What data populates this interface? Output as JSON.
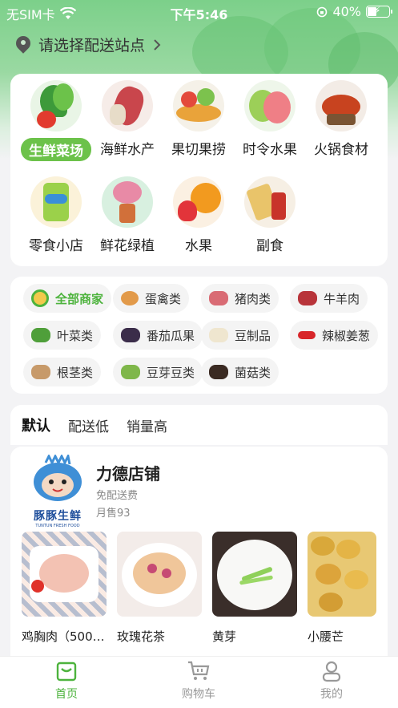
{
  "status": {
    "carrier": "无SIM卡",
    "time": "下午5:46",
    "battery": "40%"
  },
  "header": {
    "station_label": "请选择配送站点"
  },
  "categories": [
    {
      "label": "生鲜菜场",
      "icon": "vegetables-icon",
      "active": true
    },
    {
      "label": "海鲜水产",
      "icon": "seafood-icon"
    },
    {
      "label": "果切果捞",
      "icon": "fruit-platter-icon"
    },
    {
      "label": "时令水果",
      "icon": "guava-icon"
    },
    {
      "label": "火锅食材",
      "icon": "hotpot-icon"
    },
    {
      "label": "零食小店",
      "icon": "chips-icon"
    },
    {
      "label": "鲜花绿植",
      "icon": "flower-icon"
    },
    {
      "label": "水果",
      "icon": "orange-icon"
    },
    {
      "label": "副食",
      "icon": "groceries-icon"
    }
  ],
  "filters": [
    {
      "label": "全部商家",
      "active": true
    },
    {
      "label": "蛋禽类"
    },
    {
      "label": "猪肉类"
    },
    {
      "label": "牛羊肉"
    },
    {
      "label": "叶菜类"
    },
    {
      "label": "番茄瓜果"
    },
    {
      "label": "豆制品"
    },
    {
      "label": "辣椒姜葱"
    },
    {
      "label": "根茎类"
    },
    {
      "label": "豆芽豆类"
    },
    {
      "label": "菌菇类"
    }
  ],
  "sort": {
    "default": "默认",
    "delivery_low": "配送低",
    "sales_high": "销量高"
  },
  "shop": {
    "name": "力德店铺",
    "delivery": "免配送费",
    "monthly_sales": "月售93",
    "logo_text": "豚豚生鲜",
    "logo_sub": "TUNTUN FRESH FOOD",
    "products": [
      {
        "name": "鸡胸肉（500…"
      },
      {
        "name": "玫瑰花茶"
      },
      {
        "name": "黄芽"
      },
      {
        "name": "小腰芒"
      }
    ]
  },
  "tabs": {
    "home": "首页",
    "cart": "购物车",
    "mine": "我的"
  },
  "colors": {
    "accent": "#4db33d",
    "active_chip_bg": "#6cc24a"
  }
}
